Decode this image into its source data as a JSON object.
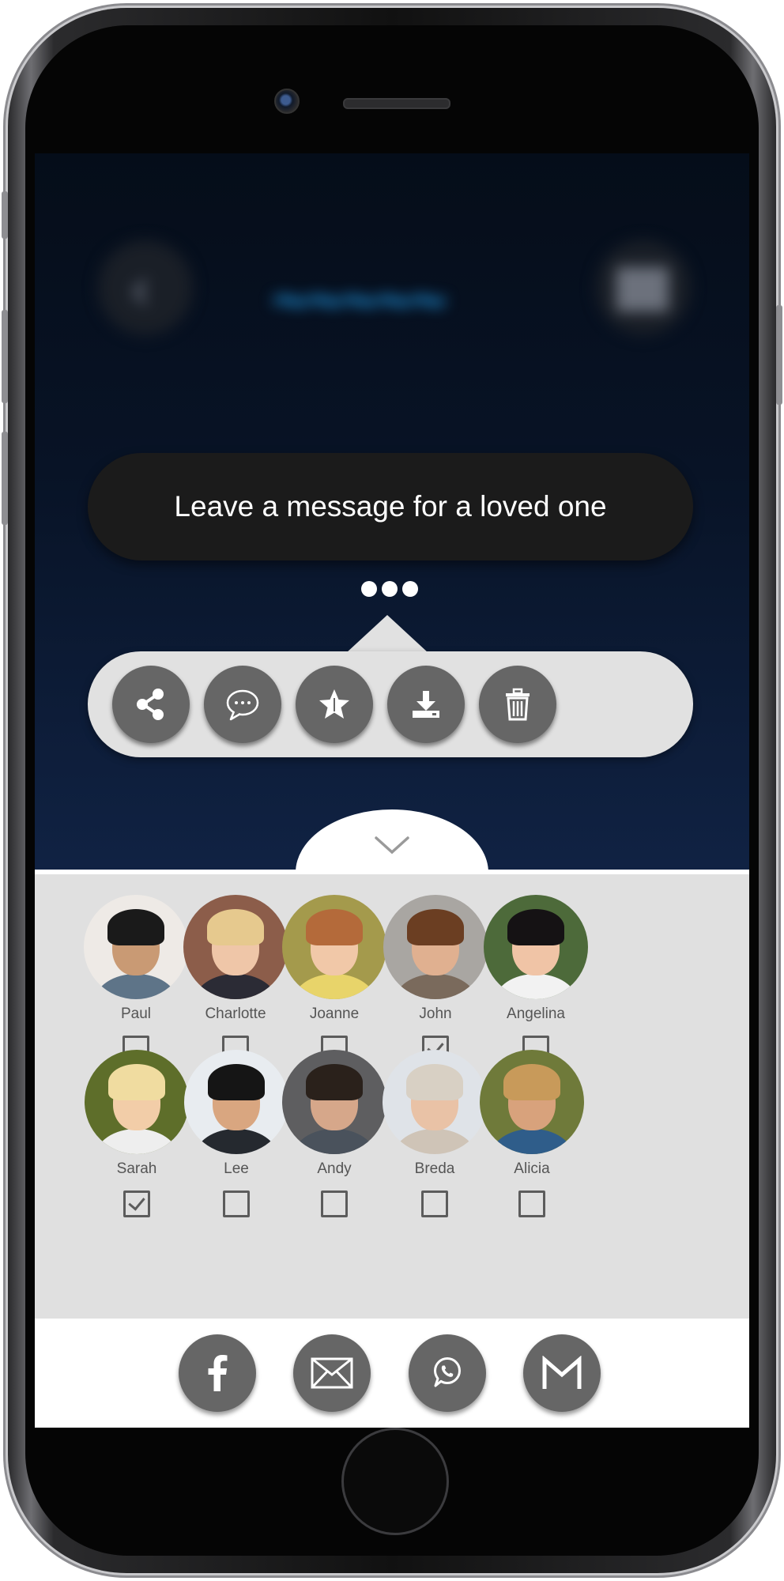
{
  "tooltip": {
    "text": "Leave a message for a loved one"
  },
  "actions": [
    "share-icon",
    "chat-bubble-icon",
    "star-icon",
    "download-icon",
    "trash-icon"
  ],
  "contacts": [
    {
      "name": "Paul",
      "checked": false
    },
    {
      "name": "Charlotte",
      "checked": false
    },
    {
      "name": "Joanne",
      "checked": false
    },
    {
      "name": "John",
      "checked": true
    },
    {
      "name": "Angelina",
      "checked": false
    },
    {
      "name": "Sarah",
      "checked": true
    },
    {
      "name": "Lee",
      "checked": false
    },
    {
      "name": "Andy",
      "checked": false
    },
    {
      "name": "Breda",
      "checked": false
    },
    {
      "name": "Alicia",
      "checked": false
    }
  ],
  "share_targets": [
    "facebook-icon",
    "email-icon",
    "whatsapp-icon",
    "gmail-icon"
  ],
  "colors": {
    "screen_top": "#050d19",
    "screen_bottom": "#1a3163",
    "tooltip_bg": "#1b1b1b",
    "action_bar_bg": "#e1e1e1",
    "button_gray": "#666666",
    "panel_bg": "#e0e0e0"
  }
}
